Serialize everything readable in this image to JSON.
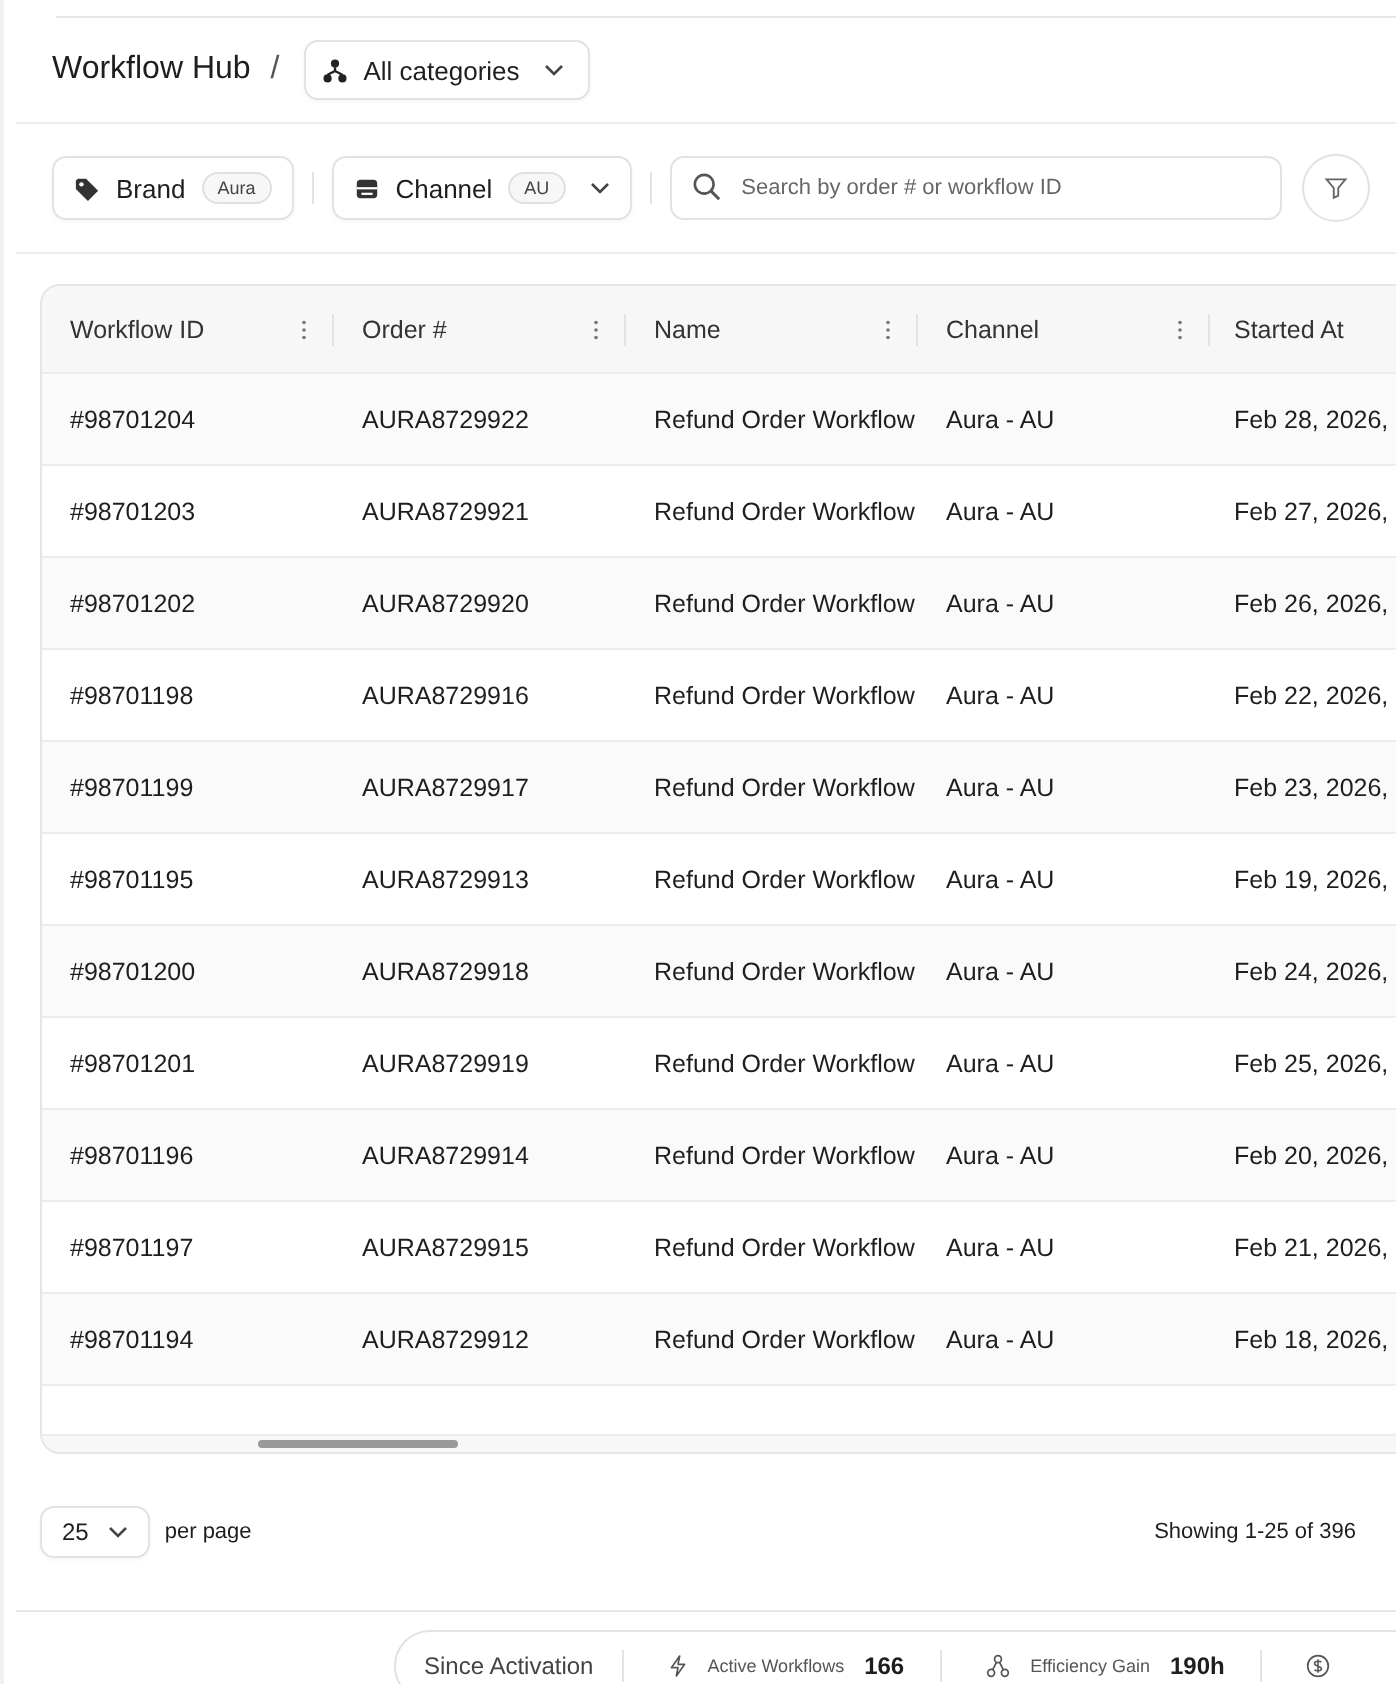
{
  "header": {
    "title": "Workflow Hub",
    "separator": "/",
    "category": {
      "label": "All categories"
    }
  },
  "filters": [
    {
      "kind": "tag",
      "label": "Brand",
      "badge": "Aura"
    },
    {
      "kind": "store",
      "label": "Channel",
      "badge": "AU"
    }
  ],
  "search": {
    "placeholder": "Search by order # or workflow ID"
  },
  "table": {
    "columns": [
      "Workflow ID",
      "Order #",
      "Name",
      "Channel",
      "Started At"
    ],
    "rows": [
      [
        "#98701204",
        "AURA8729922",
        "Refund Order Workflow",
        "Aura - AU",
        "Feb 28, 2026,"
      ],
      [
        "#98701203",
        "AURA8729921",
        "Refund Order Workflow",
        "Aura - AU",
        "Feb 27, 2026,"
      ],
      [
        "#98701202",
        "AURA8729920",
        "Refund Order Workflow",
        "Aura - AU",
        "Feb 26, 2026,"
      ],
      [
        "#98701198",
        "AURA8729916",
        "Refund Order Workflow",
        "Aura - AU",
        "Feb 22, 2026,"
      ],
      [
        "#98701199",
        "AURA8729917",
        "Refund Order Workflow",
        "Aura - AU",
        "Feb 23, 2026,"
      ],
      [
        "#98701195",
        "AURA8729913",
        "Refund Order Workflow",
        "Aura - AU",
        "Feb 19, 2026,"
      ],
      [
        "#98701200",
        "AURA8729918",
        "Refund Order Workflow",
        "Aura - AU",
        "Feb 24, 2026,"
      ],
      [
        "#98701201",
        "AURA8729919",
        "Refund Order Workflow",
        "Aura - AU",
        "Feb 25, 2026,"
      ],
      [
        "#98701196",
        "AURA8729914",
        "Refund Order Workflow",
        "Aura - AU",
        "Feb 20, 2026,"
      ],
      [
        "#98701197",
        "AURA8729915",
        "Refund Order Workflow",
        "Aura - AU",
        "Feb 21, 2026,"
      ],
      [
        "#98701194",
        "AURA8729912",
        "Refund Order Workflow",
        "Aura - AU",
        "Feb 18, 2026,"
      ]
    ]
  },
  "pagination": {
    "page_size": "25",
    "per_page_label": "per page",
    "summary": "Showing 1-25 of 396"
  },
  "stats": {
    "label": "Since Activation",
    "items": [
      {
        "kind": "bolt",
        "label": "Active Workflows",
        "value": "166"
      },
      {
        "kind": "network",
        "label": "Efficiency Gain",
        "value": "190h"
      },
      {
        "kind": "dollar"
      }
    ]
  }
}
